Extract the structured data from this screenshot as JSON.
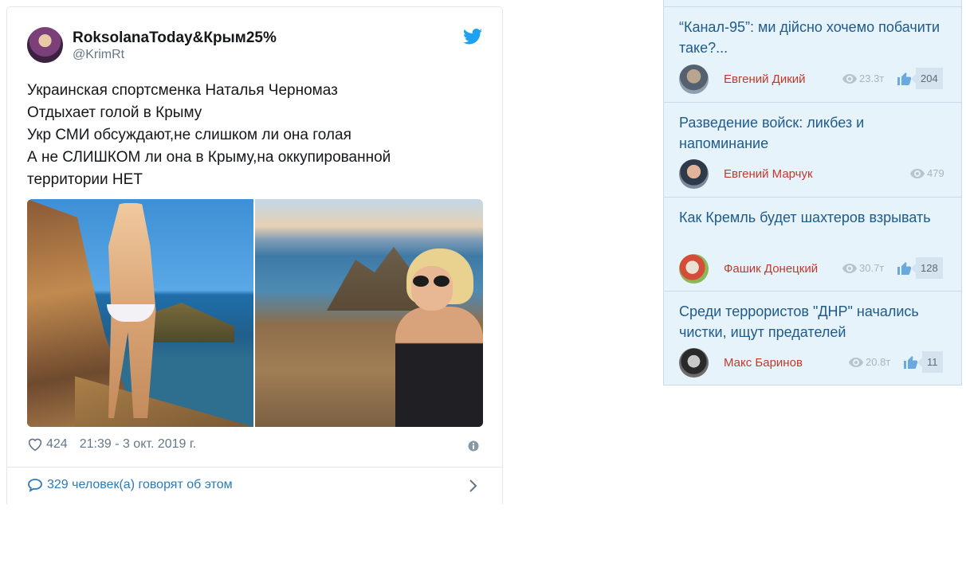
{
  "tweet": {
    "display_name": "RoksolanaToday&Крым25%",
    "handle": "@KrimRt",
    "lines": [
      "Украинская спортсменка Наталья Черномаз",
      "Отдыхает голой в Крыму",
      "Укр СМИ обсуждают,не слишком ли она голая",
      "А не СЛИШКОМ ли она в Крыму,на оккупированной",
      "территории НЕТ"
    ],
    "likes": "424",
    "timestamp": "21:39 - 3 окт. 2019 г.",
    "talk": "329 человек(а) говорят об этом",
    "accent": "#1da1f2"
  },
  "sidebar": {
    "posts": [
      {
        "title": "“Канал-95”: ми дійсно хочемо побачити таке?...",
        "author": "Евгений Дикий",
        "views": "23.3т",
        "likes": "204"
      },
      {
        "title": "Разведение войск: ликбез и напоминание",
        "author": "Евгений Марчук",
        "views": "479",
        "likes": ""
      },
      {
        "title": "Как Кремль будет шахтеров взрывать",
        "author": "Фашик Донецкий",
        "views": "30.7т",
        "likes": "128"
      },
      {
        "title": "Среди террористов \"ДНР\" начались чистки, ищут предателей",
        "author": "Макс Баринов",
        "views": "20.8т",
        "likes": "11"
      }
    ]
  }
}
